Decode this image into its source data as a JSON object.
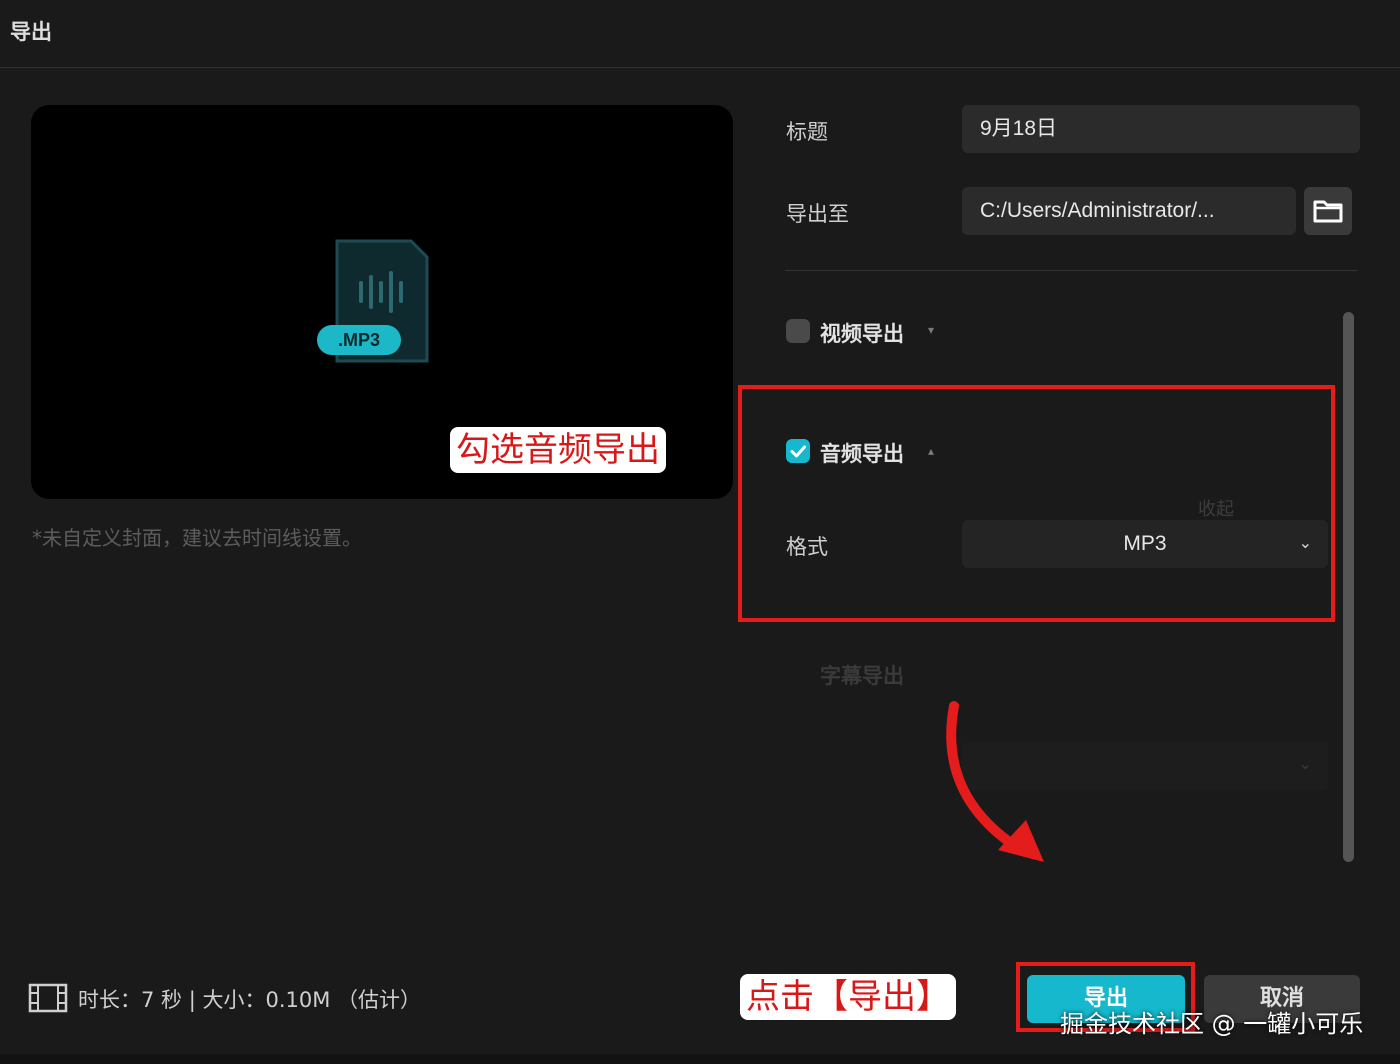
{
  "window": {
    "title": "导出"
  },
  "preview": {
    "badge_label": ".MP3",
    "annotation": "勾选音频导出",
    "hint": "*未自定义封面，建议去时间线设置。"
  },
  "form": {
    "title_label": "标题",
    "title_value": "9月18日",
    "export_to_label": "导出至",
    "export_to_value": "C:/Users/Administrator/...",
    "video_export_label": "视频导出",
    "audio_export_label": "音频导出",
    "audio_checked": true,
    "collapse_label": "收起",
    "format_label": "格式",
    "format_value": "MP3",
    "subtitle_export_label": "字幕导出"
  },
  "footer": {
    "info": "时长：7 秒 | 大小：0.10M （估计）",
    "annotation": "点击【导出】",
    "export_label": "导出",
    "cancel_label": "取消",
    "watermark": "掘金技术社区 @ 一罐小可乐"
  },
  "colors": {
    "accent": "#15b8cc",
    "highlight_red": "#e41c1c",
    "background": "#1a1a1a"
  }
}
